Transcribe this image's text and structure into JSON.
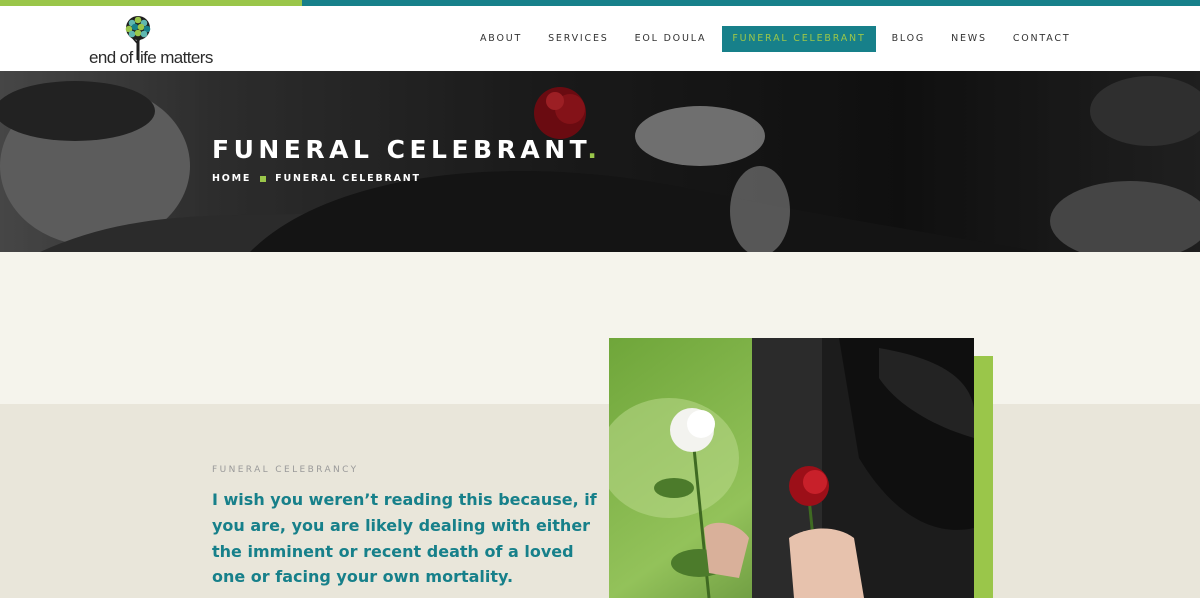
{
  "brand": {
    "logo_text": "end of life matters",
    "accent_teal": "#17808a",
    "accent_green": "#9ac64a"
  },
  "nav": {
    "items": [
      {
        "label": "ABOUT",
        "active": false
      },
      {
        "label": "SERVICES",
        "active": false
      },
      {
        "label": "EOL DOULA",
        "active": false
      },
      {
        "label": "FUNERAL CELEBRANT",
        "active": true
      },
      {
        "label": "BLOG",
        "active": false
      },
      {
        "label": "NEWS",
        "active": false
      },
      {
        "label": "CONTACT",
        "active": false
      }
    ]
  },
  "hero": {
    "title": "FUNERAL CELEBRANT",
    "title_dot": ".",
    "breadcrumb": {
      "home": "HOME",
      "current": "FUNERAL CELEBRANT"
    }
  },
  "content": {
    "eyebrow": "FUNERAL CELEBRANCY",
    "intro": "I wish you weren’t reading this because, if you are, you are likely dealing with either the imminent or recent death of a loved one or facing your own mortality."
  },
  "icons": {
    "logo": "tree-icon",
    "breadcrumb_separator": "square-bullet-icon"
  }
}
